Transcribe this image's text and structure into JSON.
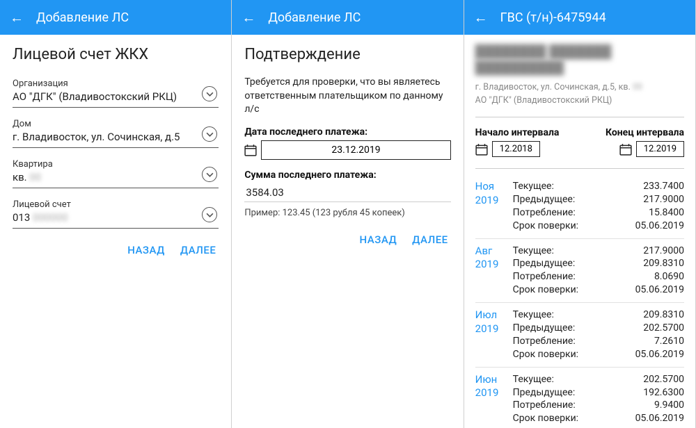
{
  "panels": {
    "p1": {
      "appbar_title": "Добавление ЛС",
      "heading": "Лицевой счет ЖКХ",
      "fields": {
        "org_label": "Организация",
        "org_value": "АО \"ДГК\" (Владивостокский РКЦ)",
        "house_label": "Дом",
        "house_value": "г. Владивосток, ул. Сочинская, д.5",
        "apt_label": "Квартира",
        "apt_value_prefix": "кв.",
        "apt_value_blur": "00",
        "acct_label": "Лицевой счет",
        "acct_value_prefix": "013",
        "acct_value_blur": "000000"
      },
      "back": "НАЗАД",
      "next": "ДАЛЕЕ"
    },
    "p2": {
      "appbar_title": "Добавление ЛС",
      "heading": "Подтверждение",
      "desc": "Требуется для проверки, что вы являетесь ответственным плательщиком по данному л/с",
      "last_pay_date_label": "Дата последнего платежа:",
      "last_pay_date_value": "23.12.2019",
      "last_pay_sum_label": "Сумма последнего платежа:",
      "last_pay_sum_value": "3584.03",
      "hint": "Пример: 123.45 (123 рубля 45 копеек)",
      "back": "НАЗАД",
      "next": "ДАЛЕЕ"
    },
    "p3": {
      "appbar_title": "ГВС (т/н)-6475944",
      "owner_line1": "████████ ███████",
      "owner_line2": "██████████",
      "addr_prefix": "г. Владивосток, ул. Сочинская, д.5, кв.",
      "addr_blur": "00",
      "org": "АО \"ДГК\" (Владивостокский РКЦ)",
      "interval_start_label": "Начало интервала",
      "interval_start_value": "12.2018",
      "interval_end_label": "Конец интервала",
      "interval_end_value": "12.2019",
      "labels": {
        "current": "Текущее:",
        "previous": "Предыдущее:",
        "usage": "Потребление:",
        "check": "Срок поверки:"
      },
      "readings": [
        {
          "mon": "Ноя",
          "yr": "2019",
          "cur": "233.7400",
          "prev": "217.9000",
          "use": "15.8400",
          "chk": "05.06.2019"
        },
        {
          "mon": "Авг",
          "yr": "2019",
          "cur": "217.9000",
          "prev": "209.8310",
          "use": "8.0690",
          "chk": "05.06.2019"
        },
        {
          "mon": "Июл",
          "yr": "2019",
          "cur": "209.8310",
          "prev": "202.5700",
          "use": "7.2610",
          "chk": "05.06.2019"
        },
        {
          "mon": "Июн",
          "yr": "2019",
          "cur": "202.5700",
          "prev": "192.6300",
          "use": "9.9400",
          "chk": "05.06.2019"
        }
      ]
    }
  }
}
